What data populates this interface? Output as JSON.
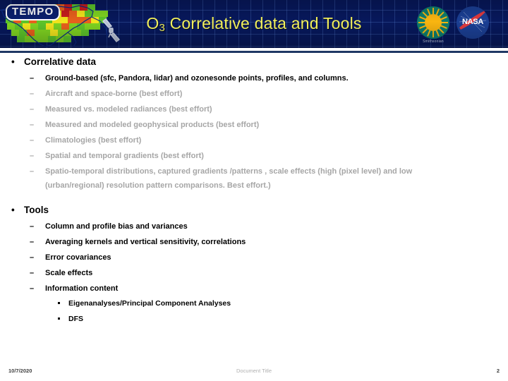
{
  "slide": {
    "title_prefix": "O",
    "title_sub": "3",
    "title_rest": " Correlative data and Tools",
    "title_plain": "O3 Correlative data and Tools",
    "accent_yellow": "#f7f55e",
    "banner_navy": "#07185c",
    "rule_navy": "#1f3864",
    "dim_gray": "#a6a6a6"
  },
  "branding": {
    "tempo_logo": "TEMPO",
    "smithsonian_label": "Smithsonian",
    "nasa_label": "NASA",
    "satellite_icon": "satellite-icon",
    "map_icon": "north-america-map"
  },
  "sections": [
    {
      "heading": "Correlative data",
      "marker": "•",
      "items": [
        {
          "text": "Ground-based (sfc, Pandora, lidar) and ozonesonde points, profiles, and columns.",
          "style": "strong"
        },
        {
          "text": "Aircraft and space-borne (best effort)",
          "style": "dim"
        },
        {
          "text": "Measured vs. modeled radiances (best effort)",
          "style": "dim"
        },
        {
          "text": "Measured and modeled geophysical products (best effort)",
          "style": "dim"
        },
        {
          "text": "Climatologies (best effort)",
          "style": "dim"
        },
        {
          "text": "Spatial and temporal gradients (best effort)",
          "style": "dim"
        },
        {
          "text": "Spatio-temporal distributions, captured gradients /patterns , scale effects (high (pixel level) and low (urban/regional) resolution pattern comparisons. Best effort.)",
          "style": "dim"
        }
      ]
    },
    {
      "heading": "Tools",
      "marker": "•",
      "items": [
        {
          "text": "Column and profile bias and variances",
          "style": "strong"
        },
        {
          "text": "Averaging kernels and vertical sensitivity, correlations",
          "style": "strong"
        },
        {
          "text": "Error covariances",
          "style": "strong"
        },
        {
          "text": "Scale effects",
          "style": "strong"
        },
        {
          "text": "Information content",
          "style": "strong"
        }
      ],
      "subitems": [
        {
          "text": "Eigenanalyses/Principal Component Analyses"
        },
        {
          "text": "DFS"
        }
      ]
    }
  ],
  "sub_marker": "–",
  "footer": {
    "date": "10/7/2020",
    "title": "Document Title",
    "page": "2"
  }
}
